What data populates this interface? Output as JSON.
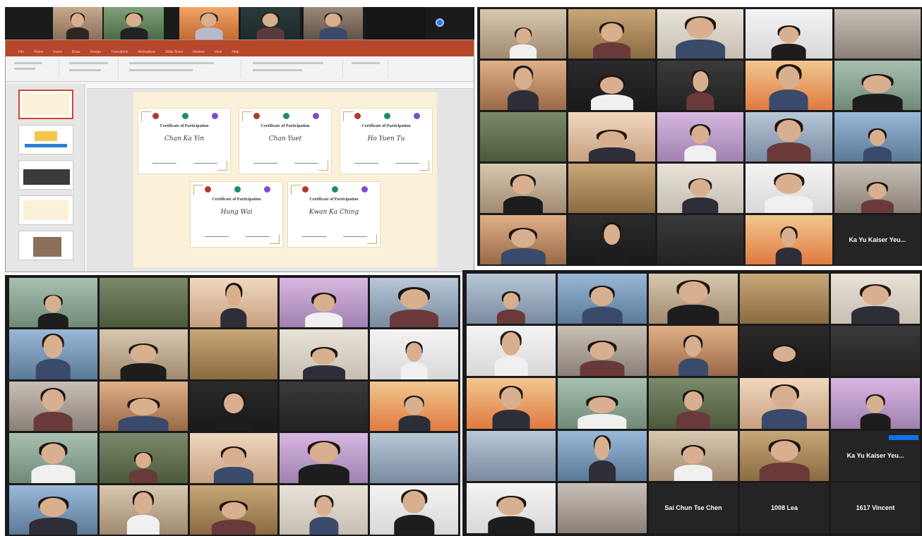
{
  "top_left_strip": {
    "tiles": [
      "",
      "",
      "",
      "",
      "",
      ""
    ]
  },
  "top_right_grid": {
    "tiles": [
      {
        "name": ""
      },
      {
        "name": ""
      },
      {
        "name": ""
      },
      {
        "name": ""
      },
      {
        "name": ""
      },
      {
        "name": ""
      },
      {
        "name": ""
      },
      {
        "name": ""
      },
      {
        "name": ""
      },
      {
        "name": ""
      },
      {
        "name": ""
      },
      {
        "name": ""
      },
      {
        "name": ""
      },
      {
        "name": ""
      },
      {
        "name": ""
      },
      {
        "name": ""
      },
      {
        "name": ""
      },
      {
        "name": ""
      },
      {
        "name": ""
      },
      {
        "name": ""
      },
      {
        "name": ""
      },
      {
        "name": ""
      },
      {
        "name": ""
      },
      {
        "name": ""
      },
      {
        "name": "Ka Yu Kaiser Yeu...",
        "center": true
      }
    ]
  },
  "bottom_left_grid": {
    "tiles": [
      {
        "name": ""
      },
      {
        "name": ""
      },
      {
        "name": ""
      },
      {
        "name": ""
      },
      {
        "name": ""
      },
      {
        "name": ""
      },
      {
        "name": ""
      },
      {
        "name": ""
      },
      {
        "name": ""
      },
      {
        "name": ""
      },
      {
        "name": ""
      },
      {
        "name": ""
      },
      {
        "name": ""
      },
      {
        "name": ""
      },
      {
        "name": ""
      },
      {
        "name": ""
      },
      {
        "name": ""
      },
      {
        "name": ""
      },
      {
        "name": ""
      },
      {
        "name": ""
      },
      {
        "name": ""
      },
      {
        "name": ""
      },
      {
        "name": ""
      },
      {
        "name": ""
      },
      {
        "name": ""
      }
    ]
  },
  "bottom_right_grid": {
    "tiles": [
      {
        "name": ""
      },
      {
        "name": ""
      },
      {
        "name": ""
      },
      {
        "name": ""
      },
      {
        "name": ""
      },
      {
        "name": ""
      },
      {
        "name": ""
      },
      {
        "name": ""
      },
      {
        "name": ""
      },
      {
        "name": ""
      },
      {
        "name": ""
      },
      {
        "name": ""
      },
      {
        "name": ""
      },
      {
        "name": ""
      },
      {
        "name": ""
      },
      {
        "name": ""
      },
      {
        "name": ""
      },
      {
        "name": ""
      },
      {
        "name": ""
      },
      {
        "name": "Ka Yu Kaiser Yeu...",
        "center": true
      },
      {
        "name": ""
      },
      {
        "name": ""
      },
      {
        "name": "Sai Chun Tse Chen",
        "center": true
      },
      {
        "name": "1008 Lea",
        "center": true
      },
      {
        "name": "1617 Vincent",
        "center": true
      }
    ]
  },
  "powerpoint": {
    "tabs": [
      "File",
      "Home",
      "Insert",
      "Draw",
      "Design",
      "Transitions",
      "Animations",
      "Slide Show",
      "Review",
      "View",
      "Help"
    ],
    "certificates": [
      {
        "title": "Certificate of Participation",
        "name": "Chan Ka Yin"
      },
      {
        "title": "Certificate of Participation",
        "name": "Chan Yuet"
      },
      {
        "title": "Certificate of Participation",
        "name": "Ho Yuen Tu"
      },
      {
        "title": "Certificate of Participation",
        "name": "Hung Wai"
      },
      {
        "title": "Certificate of Participation",
        "name": "Kwan Ka Ching"
      }
    ],
    "thumbnails": [
      "",
      "",
      "",
      "",
      ""
    ]
  },
  "colors": {
    "ppt_accent": "#b7472a",
    "zoom_bg": "#1a1a1a",
    "slide_bg": "#fbf0d8"
  }
}
